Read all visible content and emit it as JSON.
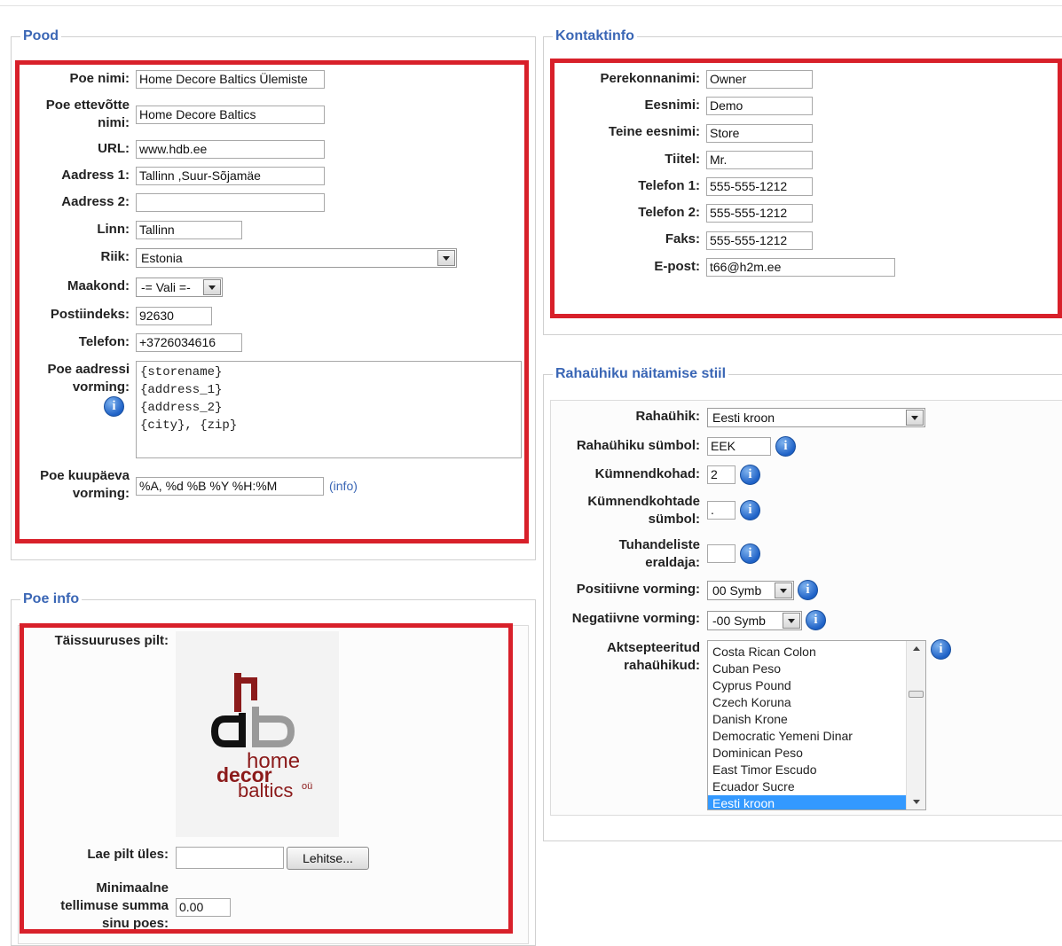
{
  "colors": {
    "accent": "#3a66b5",
    "highlight": "#d8202a",
    "selected": "#3399ff"
  },
  "store": {
    "legend": "Pood",
    "name_label": "Poe nimi:",
    "name_value": "Home Decore Baltics Ülemiste",
    "company_label_1": "Poe ettevõtte",
    "company_label_2": "nimi:",
    "company_value": "Home Decore Baltics",
    "url_label": "URL:",
    "url_value": "www.hdb.ee",
    "address1_label": "Aadress 1:",
    "address1_value": "Tallinn ,Suur-Sõjamäe",
    "address2_label": "Aadress 2:",
    "address2_value": "",
    "city_label": "Linn:",
    "city_value": "Tallinn",
    "country_label": "Riik:",
    "country_value": "Estonia",
    "county_label": "Maakond:",
    "county_value": "-= Vali =-",
    "zip_label": "Postiindeks:",
    "zip_value": "92630",
    "phone_label": "Telefon:",
    "phone_value": "+3726034616",
    "address_format_label_1": "Poe aadressi",
    "address_format_label_2": "vorming:",
    "address_format_lines": [
      "{storename}",
      "{address_1}",
      "{address_2}",
      "{city}, {zip}"
    ],
    "date_format_label_1": "Poe kuupäeva",
    "date_format_label_2": "vorming:",
    "date_format_value": "%A, %d %B %Y %H:%M",
    "date_format_link": "(info)"
  },
  "contact": {
    "legend": "Kontaktinfo",
    "fields": [
      {
        "label": "Perekonnanimi:",
        "value": "Owner"
      },
      {
        "label": "Eesnimi:",
        "value": "Demo"
      },
      {
        "label": "Teine eesnimi:",
        "value": "Store"
      },
      {
        "label": "Tiitel:",
        "value": "Mr."
      },
      {
        "label": "Telefon 1:",
        "value": "555-555-1212"
      },
      {
        "label": "Telefon 2:",
        "value": "555-555-1212"
      },
      {
        "label": "Faks:",
        "value": "555-555-1212"
      },
      {
        "label": "E-post:",
        "value": "t66@h2m.ee"
      }
    ]
  },
  "currency": {
    "legend": "Rahaühiku näitamise stiil",
    "currency_label": "Rahaühik:",
    "currency_value": "Eesti kroon",
    "symbol_label": "Rahaühiku sümbol:",
    "symbol_value": "EEK",
    "decimals_label": "Kümnendkohad:",
    "decimals_value": "2",
    "decimal_symbol_label_1": "Kümnendkohtade",
    "decimal_symbol_label_2": "sümbol:",
    "decimal_symbol_value": ".",
    "thousands_label_1": "Tuhandeliste",
    "thousands_label_2": "eraldaja:",
    "thousands_value": "",
    "positive_label": "Positiivne vorming:",
    "positive_value": "00 Symb",
    "negative_label": "Negatiivne vorming:",
    "negative_value": "-00 Symb",
    "accepted_label_1": "Aktsepteeritud",
    "accepted_label_2": "rahaühikud:",
    "accepted_options": [
      "Costa Rican Colon",
      "Cuban Peso",
      "Cyprus Pound",
      "Czech Koruna",
      "Danish Krone",
      "Democratic Yemeni Dinar",
      "Dominican Peso",
      "East Timor Escudo",
      "Ecuador Sucre",
      "Eesti kroon"
    ],
    "accepted_selected": "Eesti kroon"
  },
  "storeinfo": {
    "legend": "Poe info",
    "image_label": "Täissuuruses pilt:",
    "logo_text_1": "home",
    "logo_text_2": "decor",
    "logo_text_3": "baltics",
    "logo_text_4": "oü",
    "upload_label": "Lae pilt üles:",
    "upload_value": "",
    "browse_button": "Lehitse...",
    "min_order_label_1": "Minimaalne",
    "min_order_label_2": "tellimuse summa",
    "min_order_label_3": "sinu poes:",
    "min_order_value": "0.00"
  }
}
